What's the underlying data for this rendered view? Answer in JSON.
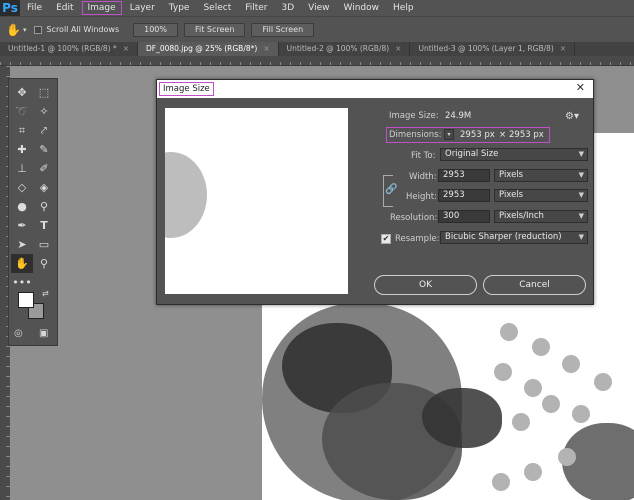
{
  "app": {
    "logo": "Ps"
  },
  "menu": [
    "File",
    "Edit",
    "Image",
    "Layer",
    "Type",
    "Select",
    "Filter",
    "3D",
    "View",
    "Window",
    "Help"
  ],
  "options": {
    "hand_icon": "hand-icon",
    "scroll_all": "Scroll All Windows",
    "zoom_100": "100%",
    "fit_screen": "Fit Screen",
    "fill_screen": "Fill Screen"
  },
  "tabs": [
    {
      "label": "Untitled-1 @ 100% (RGB/8) *"
    },
    {
      "label": "DF_0080.jpg @ 25% (RGB/8*)"
    },
    {
      "label": "Untitled-2 @ 100% (RGB/8)"
    },
    {
      "label": "Untitled-3 @ 100% (Layer 1, RGB/8)"
    }
  ],
  "ruler_labels": [
    "10",
    "5",
    "0",
    "5",
    "10",
    "15",
    "20",
    "25",
    "30",
    "35",
    "40",
    "45",
    "50",
    "55"
  ],
  "dialog": {
    "title": "Image Size",
    "image_size_label": "Image Size:",
    "image_size_value": "24.9M",
    "dimensions_label": "Dimensions:",
    "dim_w": "2953 px",
    "dim_x": "×",
    "dim_h": "2953 px",
    "fit_to_label": "Fit To:",
    "fit_to_value": "Original Size",
    "width_label": "Width:",
    "width_value": "2953",
    "width_unit": "Pixels",
    "height_label": "Height:",
    "height_value": "2953",
    "height_unit": "Pixels",
    "resolution_label": "Resolution:",
    "resolution_value": "300",
    "resolution_unit": "Pixels/Inch",
    "resample_label": "Resample:",
    "resample_value": "Bicubic Sharper (reduction)",
    "ok": "OK",
    "cancel": "Cancel",
    "close": "✕",
    "checkmark": "✔"
  },
  "colors": {
    "accent": "#c050c8",
    "panel": "#535353",
    "canvas_bg": "#8f8f8f"
  }
}
